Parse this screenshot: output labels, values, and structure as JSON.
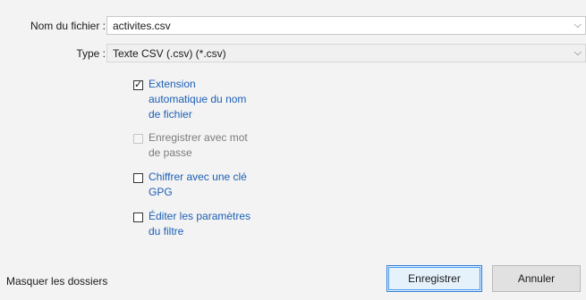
{
  "filename": {
    "label": "Nom du fichier :",
    "value": "activites.csv"
  },
  "type": {
    "label": "Type :",
    "value": "Texte CSV (.csv) (*.csv)"
  },
  "options": {
    "auto_extension": {
      "line1": "Extension",
      "line2": "automatique du nom",
      "line3": "de fichier",
      "checked": true
    },
    "password": {
      "line1": "Enregistrer avec mot",
      "line2": "de passe",
      "checked": false,
      "disabled": true
    },
    "gpg": {
      "line1": "Chiffrer avec une clé",
      "line2": "GPG",
      "checked": false
    },
    "filter": {
      "line1": "Éditer les paramètres",
      "line2": "du filtre",
      "checked": false
    }
  },
  "footer": {
    "hide_folders": "Masquer les dossiers",
    "save": "Enregistrer",
    "cancel": "Annuler"
  },
  "icons": {
    "chevron": "chevron-down-icon",
    "check": "checkmark-icon"
  }
}
